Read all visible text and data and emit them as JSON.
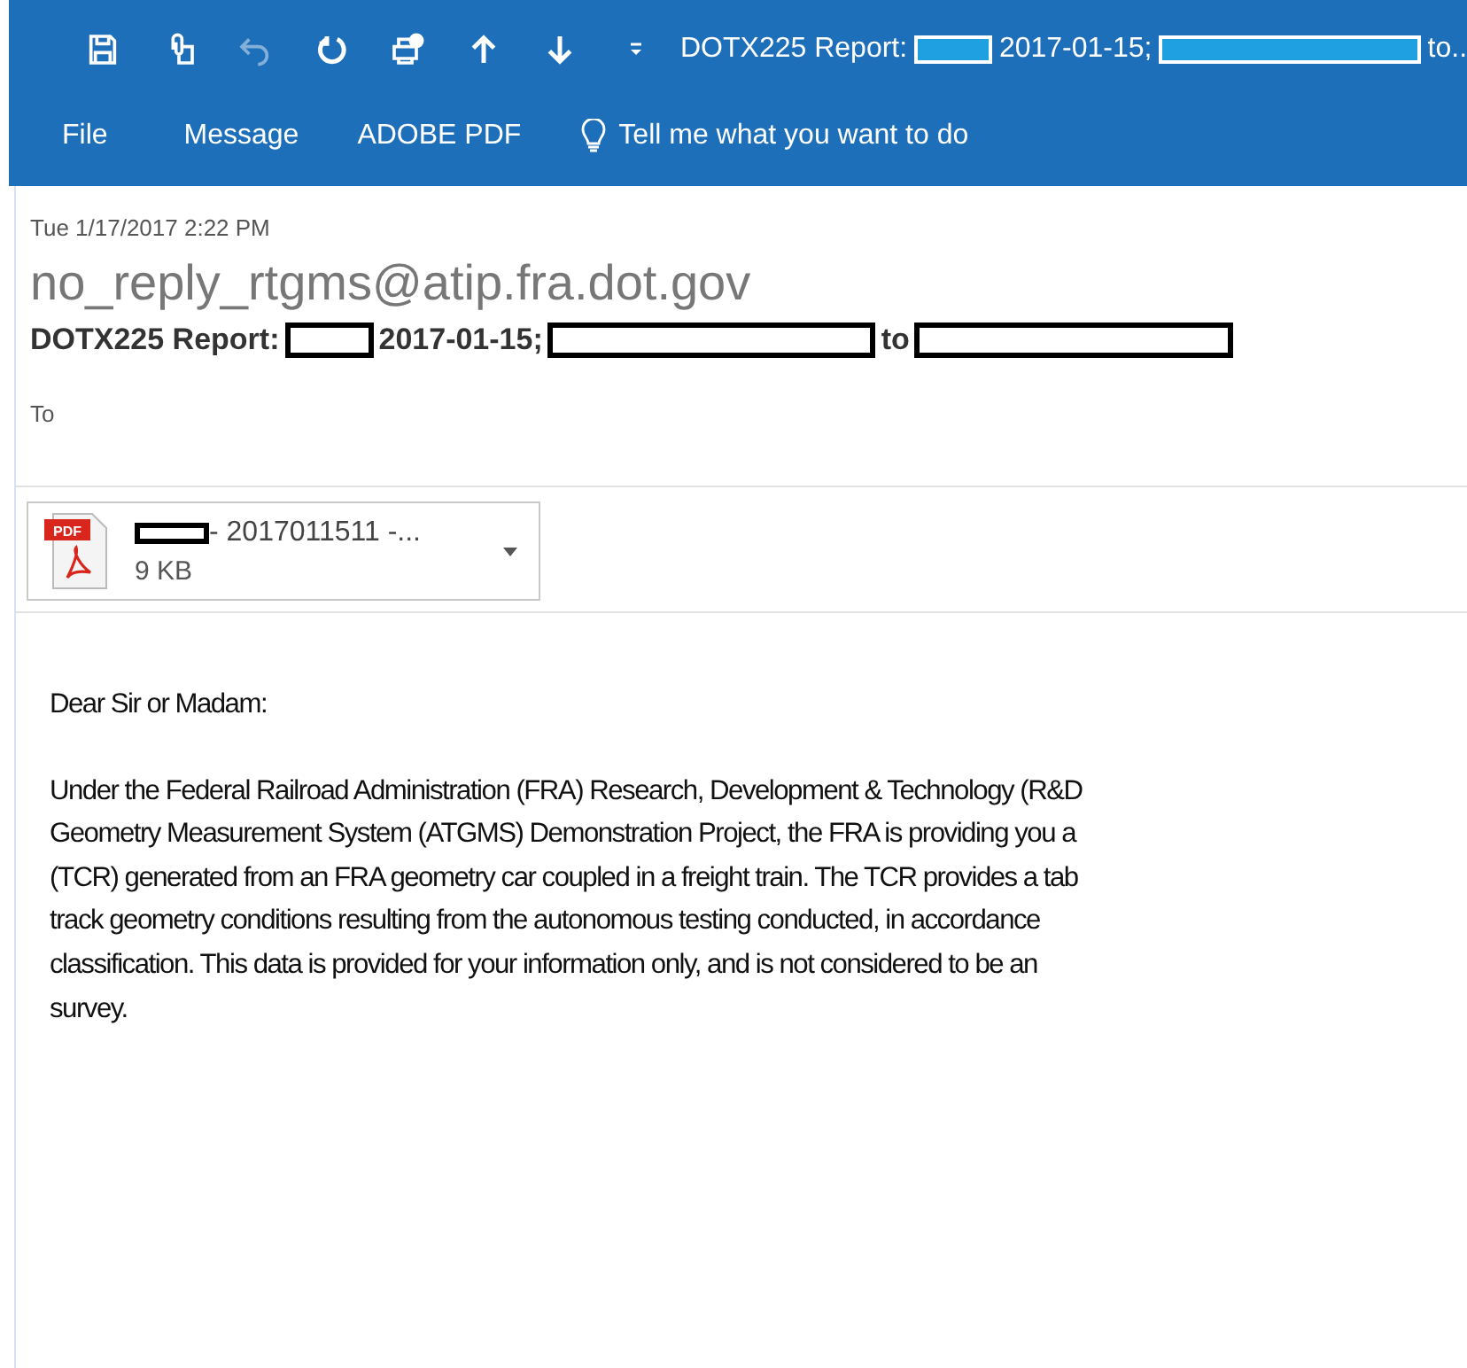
{
  "quick_access": {
    "subject_start": "DOTX225 Report:",
    "subject_date": "2017-01-15;",
    "subject_end": "to.."
  },
  "ribbon_tabs": [
    {
      "label": "File",
      "kind": "tab"
    },
    {
      "label": "Message",
      "kind": "tab"
    },
    {
      "label": "ADOBE PDF",
      "kind": "tab"
    },
    {
      "label": "Tell me what you want to do",
      "kind": "search"
    }
  ],
  "message": {
    "date": "Tue 1/17/2017 2:22 PM",
    "sender": "no_reply_rtgms@atip.fra.dot.gov",
    "subject_start": "DOTX225 Report:",
    "subject_date": "2017-01-15;",
    "subject_to": "to",
    "to_label": "To"
  },
  "attachment": {
    "name": "- 2017011511 -...",
    "size": "9 KB",
    "badge": "PDF"
  },
  "body": {
    "greeting": "Dear Sir or Madam:",
    "lines": [
      "Under the Federal Railroad Administration (FRA) Research, Development & Technology (R&D",
      "Geometry Measurement System (ATGMS) Demonstration Project, the FRA is providing you a",
      "(TCR) generated from an FRA geometry car coupled in a freight train.  The TCR provides a tab",
      "track geometry conditions resulting from the autonomous testing conducted, in accordance",
      "classification.  This data is provided for your information only, and is not considered to be an",
      "survey."
    ]
  }
}
